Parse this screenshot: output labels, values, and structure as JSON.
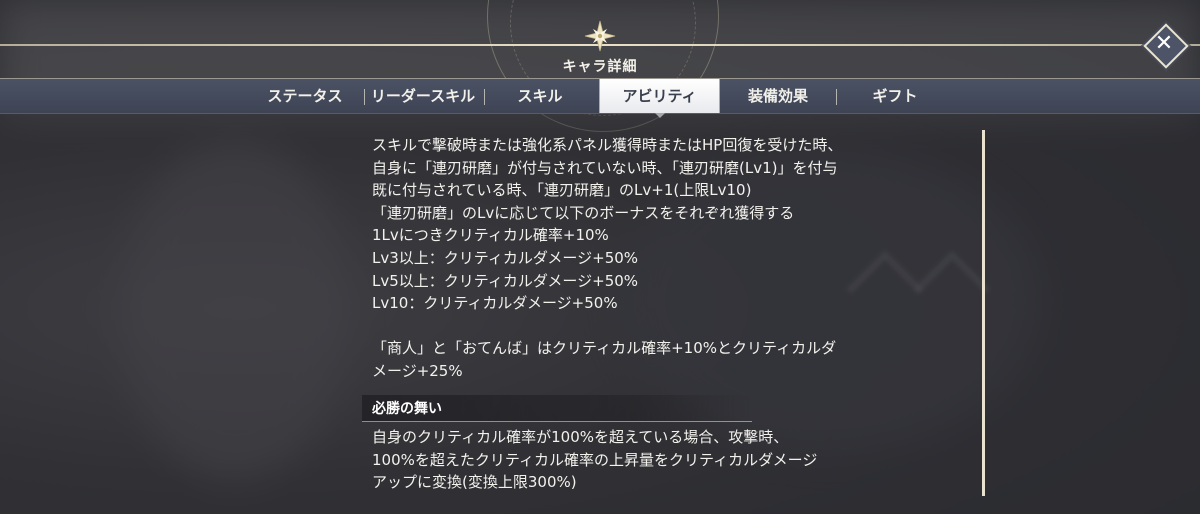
{
  "header": {
    "title": "キャラ詳細"
  },
  "tabs": [
    {
      "label": "ステータス"
    },
    {
      "label": "リーダースキル"
    },
    {
      "label": "スキル"
    },
    {
      "label": "アビリティ"
    },
    {
      "label": "装備効果"
    },
    {
      "label": "ギフト"
    }
  ],
  "active_tab": "アビリティ",
  "ability": {
    "lines": [
      "スキルで撃破時または強化系パネル獲得時またはHP回復を受けた時、",
      "自身に「連刃研磨」が付与されていない時、「連刃研磨(Lv1)」を付与",
      "既に付与されている時、「連刃研磨」のLv+1(上限Lv10)",
      "「連刃研磨」のLvに応じて以下のボーナスをそれぞれ獲得する",
      "1Lvにつきクリティカル確率+10%",
      "Lv3以上：クリティカルダメージ+50%",
      "Lv5以上：クリティカルダメージ+50%",
      "Lv10：クリティカルダメージ+50%"
    ],
    "extra_lines": [
      "「商人」と「おてんば」はクリティカル確率+10%とクリティカルダ",
      "メージ+25%"
    ]
  },
  "section2": {
    "title": "必勝の舞い",
    "lines": [
      "自身のクリティカル確率が100%を超えている場合、攻撃時、",
      "100%を超えたクリティカル確率の上昇量をクリティカルダメージ",
      "アップに変換(変換上限300%)"
    ]
  },
  "colors": {
    "accent_line": "#e9e3cf",
    "tab_bar": "#434a5b",
    "active_tab_bg": "#ffffff",
    "text": "#f3f1ec"
  },
  "icons": {
    "emblem": "compass-star-icon",
    "close": "close-icon"
  }
}
